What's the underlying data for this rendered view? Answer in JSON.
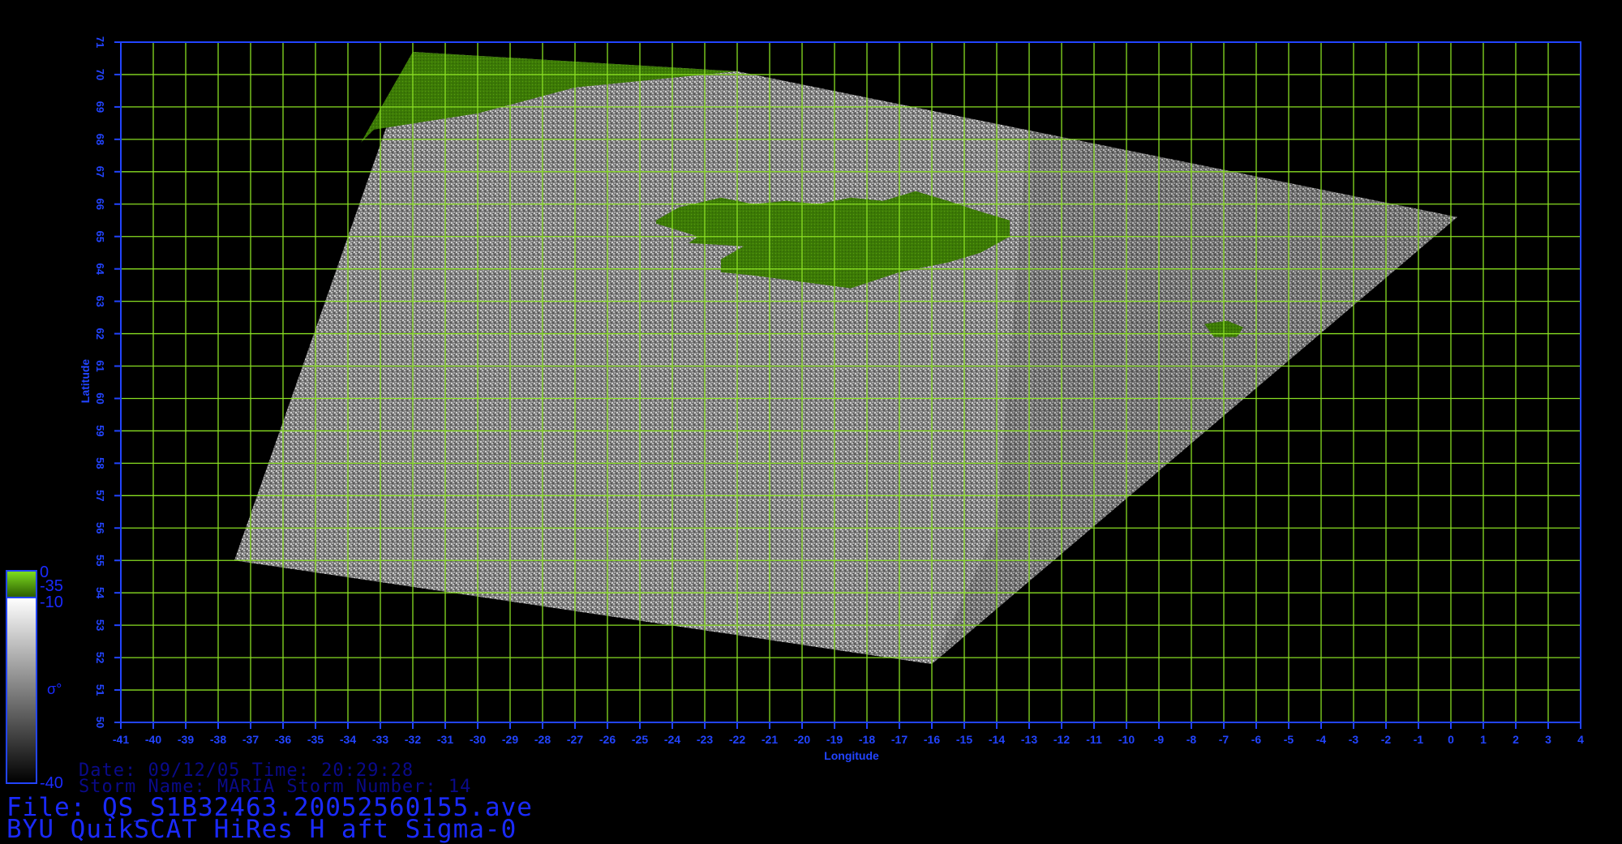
{
  "map": {
    "xlabel": "Longitude",
    "ylabel": "Latitude",
    "lon_min": -41,
    "lon_max": 4,
    "lat_min": 50,
    "lat_max": 71,
    "lon_ticks": [
      "-41",
      "-40",
      "-39",
      "-38",
      "-37",
      "-36",
      "-35",
      "-34",
      "-33",
      "-32",
      "-31",
      "-30",
      "-29",
      "-28",
      "-27",
      "-26",
      "-25",
      "-24",
      "-23",
      "-22",
      "-21",
      "-20",
      "-19",
      "-18",
      "-17",
      "-16",
      "-15",
      "-14",
      "-13",
      "-12",
      "-11",
      "-10",
      "-9",
      "-8",
      "-7",
      "-6",
      "-5",
      "-4",
      "-3",
      "-2",
      "-1",
      "0",
      "1",
      "2",
      "3",
      "4"
    ],
    "lat_ticks": [
      "50",
      "51",
      "52",
      "53",
      "54",
      "55",
      "56",
      "57",
      "58",
      "59",
      "60",
      "61",
      "62",
      "63",
      "64",
      "65",
      "66",
      "67",
      "68",
      "69",
      "70",
      "71"
    ],
    "swath_corners": [
      [
        -32,
        70.7
      ],
      [
        -22,
        70.1
      ],
      [
        0.2,
        65.6
      ],
      [
        -16,
        51.8
      ],
      [
        -37.5,
        55
      ]
    ],
    "grid_color": "#88dd22",
    "axis_color": "#2244ff",
    "land_color": "#3c7a06"
  },
  "legend": {
    "land_top": "0",
    "land_bottom": "-35",
    "scale_top": "-10",
    "scale_bottom": "-40",
    "symbol": "σ°"
  },
  "info": {
    "date_line": "Date: 09/12/05   Time: 20:29:28",
    "storm_line": "Storm  Name: MARIA   Storm  Number: 14",
    "file_line": "File: QS_S1B32463.20052560155.ave",
    "product_line": "BYU  QuikSCAT  HiRes  H  aft  Sigma-0"
  }
}
